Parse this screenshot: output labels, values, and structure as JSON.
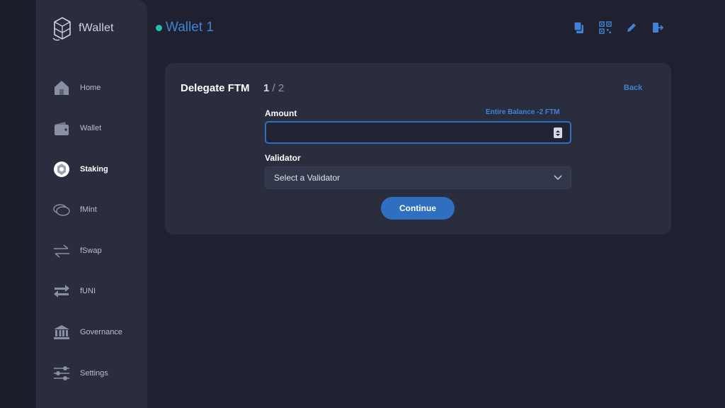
{
  "app": {
    "name": "fWallet"
  },
  "sidebar": {
    "items": [
      {
        "label": "Home",
        "icon": "home-icon"
      },
      {
        "label": "Wallet",
        "icon": "wallet-icon"
      },
      {
        "label": "Staking",
        "icon": "staking-icon",
        "active": true
      },
      {
        "label": "fMint",
        "icon": "fmint-icon"
      },
      {
        "label": "fSwap",
        "icon": "fswap-icon"
      },
      {
        "label": "fUNI",
        "icon": "funi-icon"
      },
      {
        "label": "Governance",
        "icon": "governance-icon"
      },
      {
        "label": "Settings",
        "icon": "settings-icon"
      }
    ]
  },
  "header": {
    "wallet_name": "Wallet 1",
    "status_color": "#1fbfb0",
    "actions": [
      "copy-icon",
      "qr-code-icon",
      "edit-icon",
      "logout-icon"
    ]
  },
  "form": {
    "title": "Delegate FTM",
    "step_current": "1",
    "step_total": "/ 2",
    "back_label": "Back",
    "amount_label": "Amount",
    "entire_balance_label": "Entire Balance -2 FTM",
    "amount_value": "",
    "validator_label": "Validator",
    "validator_selected": "Select a Validator",
    "continue_label": "Continue"
  },
  "colors": {
    "accent": "#3f82d6",
    "button": "#2f6fc0",
    "background": "#1f2130",
    "panel": "#2a2d3e"
  }
}
